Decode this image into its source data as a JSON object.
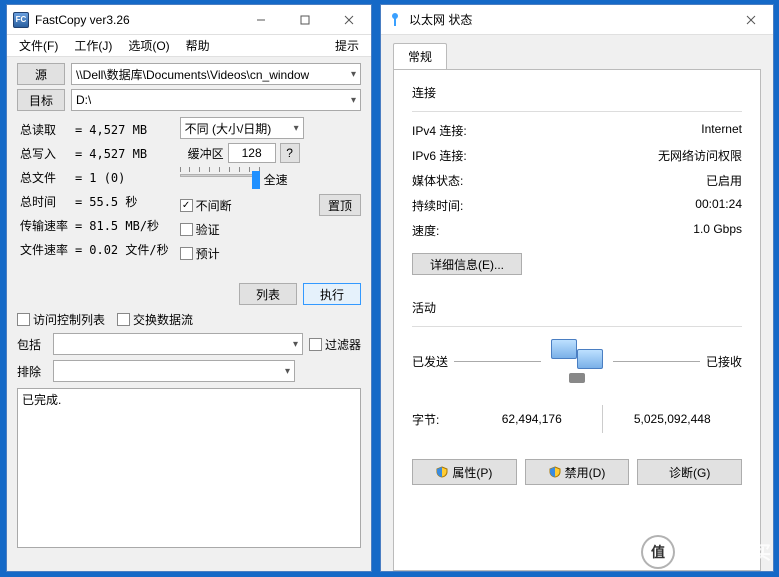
{
  "fc": {
    "title": "FastCopy ver3.26",
    "menu": {
      "file": "文件(F)",
      "work": "工作(J)",
      "options": "选项(O)",
      "help": "帮助",
      "tip": "提示"
    },
    "src_btn": "源",
    "dst_btn": "目标",
    "src_path": "\\\\Dell\\数据库\\Documents\\Videos\\cn_window",
    "dst_path": "D:\\",
    "stats": {
      "read_l": "总读取",
      "read_v": "4,527 MB",
      "write_l": "总写入",
      "write_v": "4,527 MB",
      "files_l": "总文件",
      "files_v": "1 (0)",
      "time_l": "总时间",
      "time_v": "55.5 秒",
      "rate_l": "传输速率",
      "rate_v": "81.5 MB/秒",
      "frate_l": "文件速率",
      "frate_v": "0.02 文件/秒"
    },
    "mode": "不同 (大小/日期)",
    "buffer_label": "缓冲区",
    "buffer_value": "128",
    "buffer_q": "?",
    "speed_full": "全速",
    "chk_nonstop": "不间断",
    "chk_verify": "验证",
    "chk_estimate": "预计",
    "btn_top": "置顶",
    "btn_list": "列表",
    "btn_exec": "执行",
    "chk_acl": "访问控制列表",
    "chk_swap": "交换数据流",
    "chk_filter": "过滤器",
    "include_label": "包括",
    "exclude_label": "排除",
    "status": "已完成."
  },
  "eth": {
    "title": "以太网 状态",
    "tab": "常规",
    "conn_section": "连接",
    "ipv4_l": "IPv4 连接:",
    "ipv4_v": "Internet",
    "ipv6_l": "IPv6 连接:",
    "ipv6_v": "无网络访问权限",
    "media_l": "媒体状态:",
    "media_v": "已启用",
    "dur_l": "持续时间:",
    "dur_v": "00:01:24",
    "speed_l": "速度:",
    "speed_v": "1.0 Gbps",
    "details_btn": "详细信息(E)...",
    "activity_section": "活动",
    "sent": "已发送",
    "recv": "已接收",
    "bytes_l": "字节:",
    "bytes_sent": "62,494,176",
    "bytes_recv": "5,025,092,448",
    "btn_props": "属性(P)",
    "btn_disable": "禁用(D)",
    "btn_diag": "诊断(G)"
  },
  "watermark": "什么值得买"
}
